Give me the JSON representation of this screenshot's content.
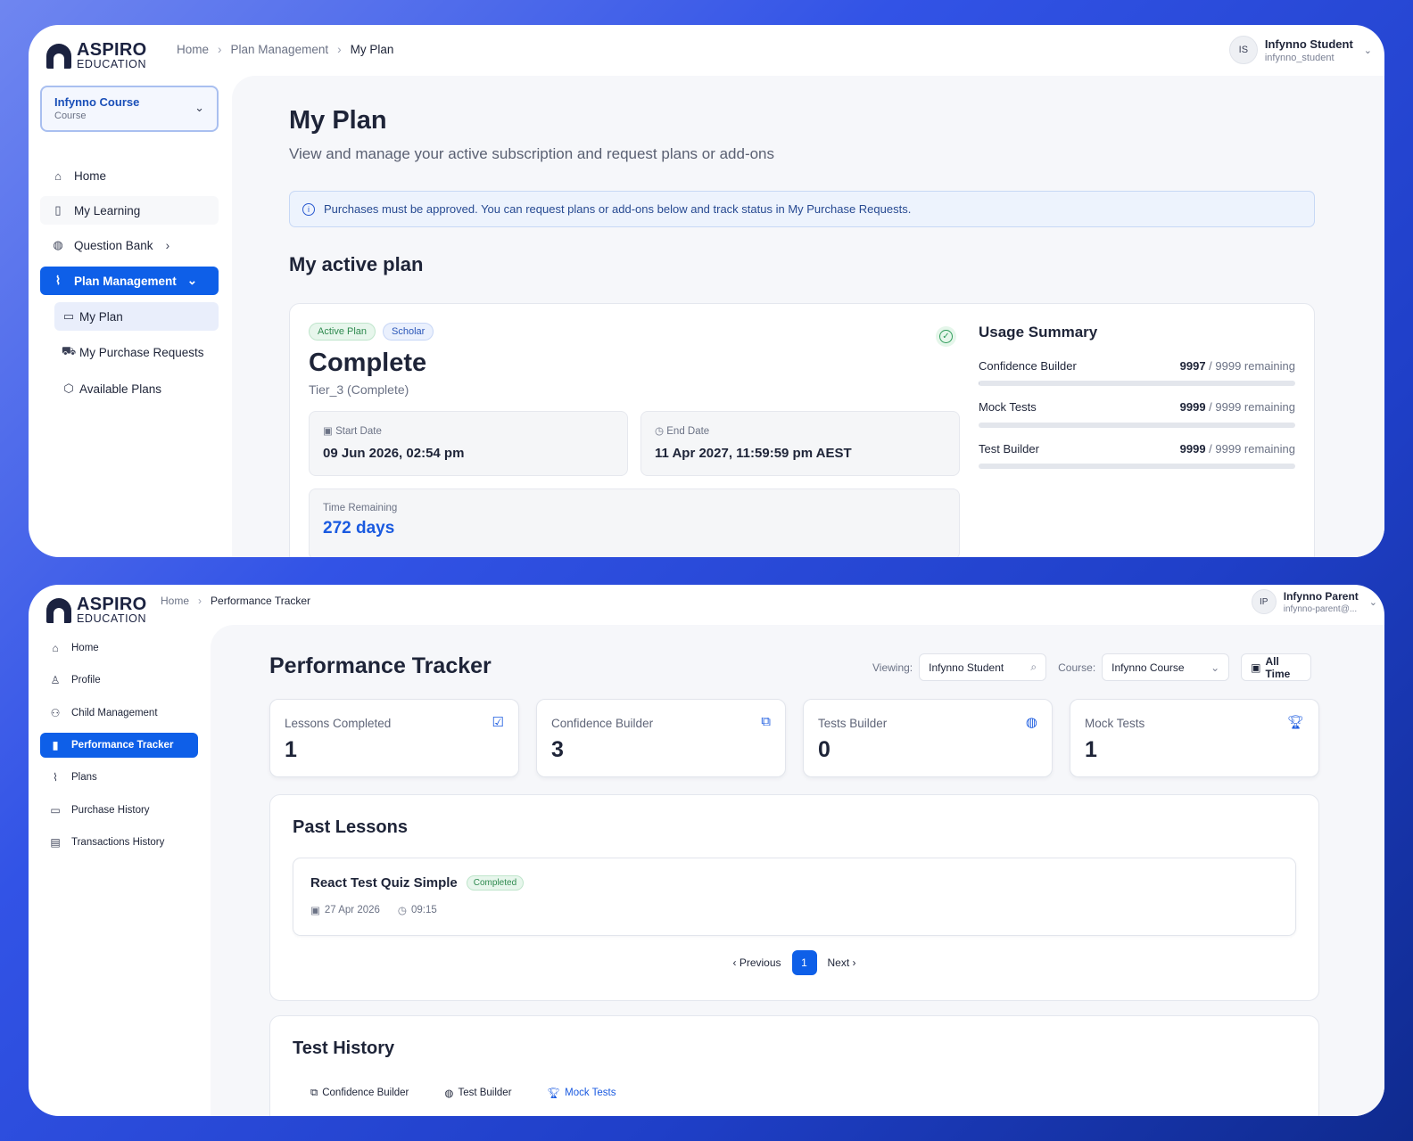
{
  "plan": {
    "brand": {
      "name": "ASPIRO",
      "sub": "EDUCATION"
    },
    "breadcrumb": [
      "Home",
      "Plan Management",
      "My Plan"
    ],
    "user": {
      "initials": "IS",
      "name": "Infynno Student",
      "handle": "infynno_student"
    },
    "course_select": {
      "title": "Infynno Course",
      "sub": "Course"
    },
    "nav": {
      "home": "Home",
      "learning": "My Learning",
      "qbank": "Question Bank",
      "plan_mgmt": "Plan Management",
      "my_plan": "My Plan",
      "requests": "My Purchase Requests",
      "available": "Available Plans"
    },
    "title": "My Plan",
    "subtitle": "View and manage your active subscription and request plans or add-ons",
    "notice": "Purchases must be approved. You can request plans or add-ons below and track status in My Purchase Requests.",
    "active_heading": "My active plan",
    "tags": [
      "Active Plan",
      "Scholar"
    ],
    "plan_name": "Complete",
    "tier": "Tier_3 (Complete)",
    "start_label": "Start Date",
    "start_value": "09 Jun 2026, 02:54 pm",
    "end_label": "End Date",
    "end_value": "11 Apr 2027, 11:59:59 pm AEST",
    "remaining_label": "Time Remaining",
    "remaining_value": "272 days",
    "usage": {
      "title": "Usage Summary",
      "suffix": " / 9999 remaining",
      "items": [
        {
          "name": "Confidence Builder",
          "used": "9997",
          "total": 9999
        },
        {
          "name": "Mock Tests",
          "used": "9999",
          "total": 9999
        },
        {
          "name": "Test Builder",
          "used": "9999",
          "total": 9999
        }
      ]
    }
  },
  "tracker": {
    "brand": {
      "name": "ASPIRO",
      "sub": "EDUCATION"
    },
    "breadcrumb": [
      "Home",
      "Performance Tracker"
    ],
    "user": {
      "initials": "IP",
      "name": "Infynno Parent",
      "handle": "infynno-parent@..."
    },
    "nav": {
      "home": "Home",
      "profile": "Profile",
      "child": "Child Management",
      "perf": "Performance Tracker",
      "plans": "Plans",
      "purchase": "Purchase History",
      "transactions": "Transactions History"
    },
    "title": "Performance Tracker",
    "filters": {
      "viewing_label": "Viewing:",
      "viewing_value": "Infynno Student",
      "course_label": "Course:",
      "course_value": "Infynno Course",
      "time": "All Time"
    },
    "stats": [
      {
        "label": "Lessons Completed",
        "value": "1"
      },
      {
        "label": "Confidence Builder",
        "value": "3"
      },
      {
        "label": "Tests Builder",
        "value": "0"
      },
      {
        "label": "Mock Tests",
        "value": "1"
      }
    ],
    "past_lessons": {
      "title": "Past Lessons",
      "lesson": {
        "name": "React Test Quiz Simple",
        "status": "Completed",
        "date": "27 Apr 2026",
        "time": "09:15"
      }
    },
    "pagination": {
      "prev": "Previous",
      "page": "1",
      "next": "Next"
    },
    "test_history": {
      "title": "Test History",
      "tabs": [
        "Confidence Builder",
        "Test Builder",
        "Mock Tests"
      ]
    }
  },
  "colors": {
    "accent": "#0e5fe8",
    "link": "#1a5ae0",
    "success": "#2e9b5a"
  }
}
